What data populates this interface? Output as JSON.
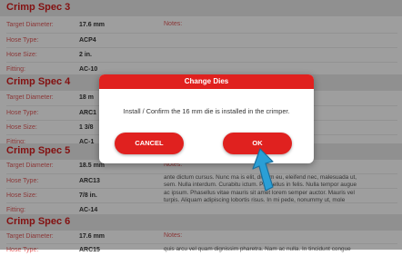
{
  "labels": {
    "target_diameter": "Target Diameter:",
    "hose_type": "Hose Type:",
    "hose_size": "Hose Size:",
    "fitting": "Fitting:",
    "notes": "Notes:"
  },
  "specs": [
    {
      "title": "Crimp Spec 3",
      "target_diameter": "17.6 mm",
      "hose_type": "ACP4",
      "hose_size": "2 in.",
      "fitting": "AC-10"
    },
    {
      "title": "Crimp Spec 4",
      "target_diameter": "18 m",
      "hose_type": "ARC1",
      "hose_size": "1 3/8",
      "fitting": "AC-1"
    },
    {
      "title": "Crimp Spec 5",
      "target_diameter": "18.5 mm",
      "hose_type": "ARC13",
      "hose_size": "7/8 in.",
      "fitting": "AC-14",
      "notes_lines": [
        "ante dictum cursus. Nunc ma   is elit, dictum eu, eleifend nec, malesuada ut,",
        "sem. Nulla interdum. Curabitu  ictum. Phasellus in felis. Nulla tempor augue",
        "ac ipsum. Phasellus vitae mauris sit amet lorem semper auctor. Mauris vel",
        "turpis. Aliquam adipiscing lobortis risus. In mi pede, nonummy ut, mole"
      ]
    },
    {
      "title": "Crimp Spec 6",
      "target_diameter": "17.6 mm",
      "hose_type": "ARC15",
      "notes_lines": [
        "quis arcu vel quam dignissim pharetra. Nam ac nulla. In tincidunt congue"
      ]
    }
  ],
  "dialog": {
    "title": "Change Dies",
    "message": "Install / Confirm the 16 mm die is installed in the crimper.",
    "cancel_label": "CANCEL",
    "ok_label": "OK"
  },
  "colors": {
    "accent": "#e0211f",
    "label": "#e05a5a",
    "header_bg": "#e9e9e9",
    "pointer": "#2a9fd6"
  },
  "icons": {
    "pointer": "pointer-arrow-icon"
  }
}
